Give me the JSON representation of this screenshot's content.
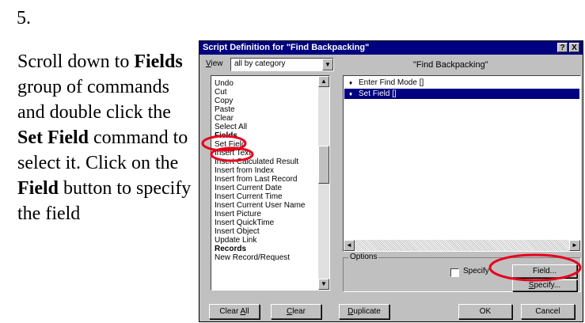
{
  "step_number": "5.",
  "instructions": {
    "p1": "Scroll down to ",
    "b1": "Fields",
    "p2": " group of commands and double click the ",
    "b2": "Set Field",
    "p3": " command to select it.  Click on the ",
    "b3": "Field",
    "p4": " button to specify the field"
  },
  "dialog": {
    "title": "Script Definition for \"Find Backpacking\"",
    "help_icon": "?",
    "close_icon": "X",
    "view_label_pre": "",
    "view_label_u": "V",
    "view_label_post": "iew",
    "view_value": "all by category",
    "script_title": "\"Find Backpacking\"",
    "commands": [
      {
        "text": "Undo",
        "bold": false
      },
      {
        "text": "Cut",
        "bold": false
      },
      {
        "text": "Copy",
        "bold": false
      },
      {
        "text": "Paste",
        "bold": false
      },
      {
        "text": "Clear",
        "bold": false
      },
      {
        "text": "Select All",
        "bold": false
      },
      {
        "text": "Fields",
        "bold": true
      },
      {
        "text": "Set Field",
        "bold": false
      },
      {
        "text": "Insert Text",
        "bold": false
      },
      {
        "text": "Insert Calculated Result",
        "bold": false
      },
      {
        "text": "Insert from Index",
        "bold": false
      },
      {
        "text": "Insert from Last Record",
        "bold": false
      },
      {
        "text": "Insert Current Date",
        "bold": false
      },
      {
        "text": "Insert Current Time",
        "bold": false
      },
      {
        "text": "Insert Current User Name",
        "bold": false
      },
      {
        "text": "Insert Picture",
        "bold": false
      },
      {
        "text": "Insert QuickTime",
        "bold": false
      },
      {
        "text": "Insert Object",
        "bold": false
      },
      {
        "text": "Update Link",
        "bold": false
      },
      {
        "text": "Records",
        "bold": true
      },
      {
        "text": "New Record/Request",
        "bold": false
      }
    ],
    "steps": [
      {
        "text": "Enter Find Mode []",
        "selected": false
      },
      {
        "text": "Set Field []",
        "selected": true
      }
    ],
    "bullet": "♦",
    "options_label": "Options",
    "specify_check_label": "Specify",
    "field_button": "Field...",
    "specify_button_u": "S",
    "specify_button_rest": "pecify...",
    "clear_all_pre": "Clear ",
    "clear_all_u": "A",
    "clear_all_post": "ll",
    "clear_u": "C",
    "clear_rest": "lear",
    "duplicate_u": "D",
    "duplicate_rest": "uplicate",
    "ok_button": "OK",
    "cancel_button": "Cancel",
    "scroll_up_icon": "▲",
    "scroll_down_icon": "▼",
    "scroll_left_icon": "◄",
    "scroll_right_icon": "►",
    "dropdown_icon": "▼"
  },
  "colors": {
    "highlight_circle": "#e8001c",
    "title_bar": "#000080",
    "dialog_face": "#c0c0c0"
  }
}
